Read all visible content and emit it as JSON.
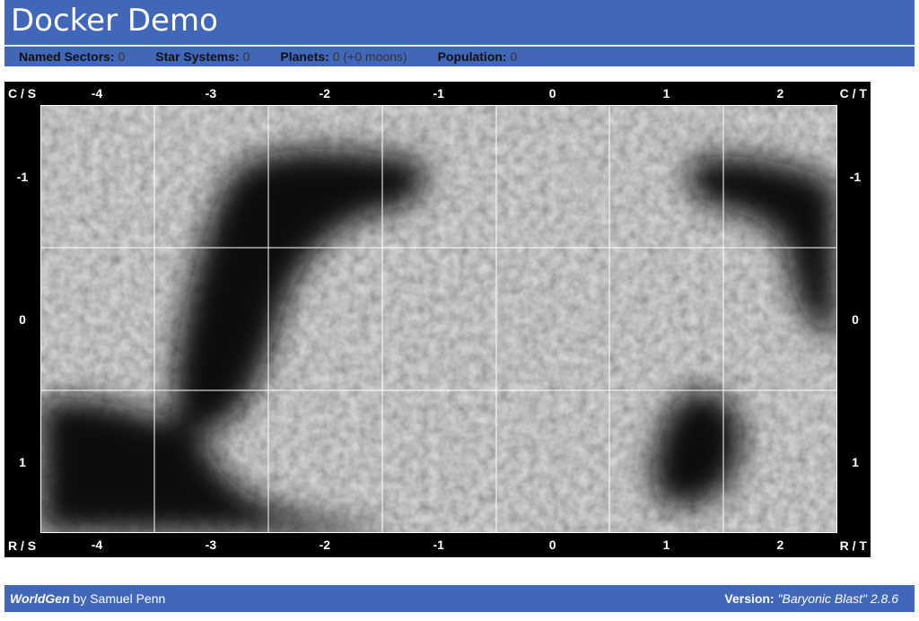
{
  "header": {
    "title": "Docker Demo"
  },
  "stats": [
    {
      "label": "Named Sectors:",
      "value": "0"
    },
    {
      "label": "Star Systems:",
      "value": "0"
    },
    {
      "label": "Planets:",
      "value": "0 (+0 moons)"
    },
    {
      "label": "Population:",
      "value": "0"
    }
  ],
  "map": {
    "corners": {
      "top_left": "C / S",
      "top_right": "C / T",
      "bottom_left": "R / S",
      "bottom_right": "R / T"
    },
    "columns": [
      "-4",
      "-3",
      "-2",
      "-1",
      "0",
      "1",
      "2"
    ],
    "rows": [
      "-1",
      "0",
      "1"
    ],
    "colors": {
      "frame": "#000000",
      "grid_line": "#ffffff",
      "nebula_light": "#9a9a9a",
      "nebula_dark": "#111111"
    }
  },
  "footer": {
    "app_name": "WorldGen",
    "by": " by Samuel Penn",
    "version_label": "Version:",
    "version_name": "\"Baryonic Blast\"",
    "version_number": " 2.8.6"
  },
  "colors": {
    "brand": "#4168b8",
    "text_on_brand": "#ffffff"
  }
}
